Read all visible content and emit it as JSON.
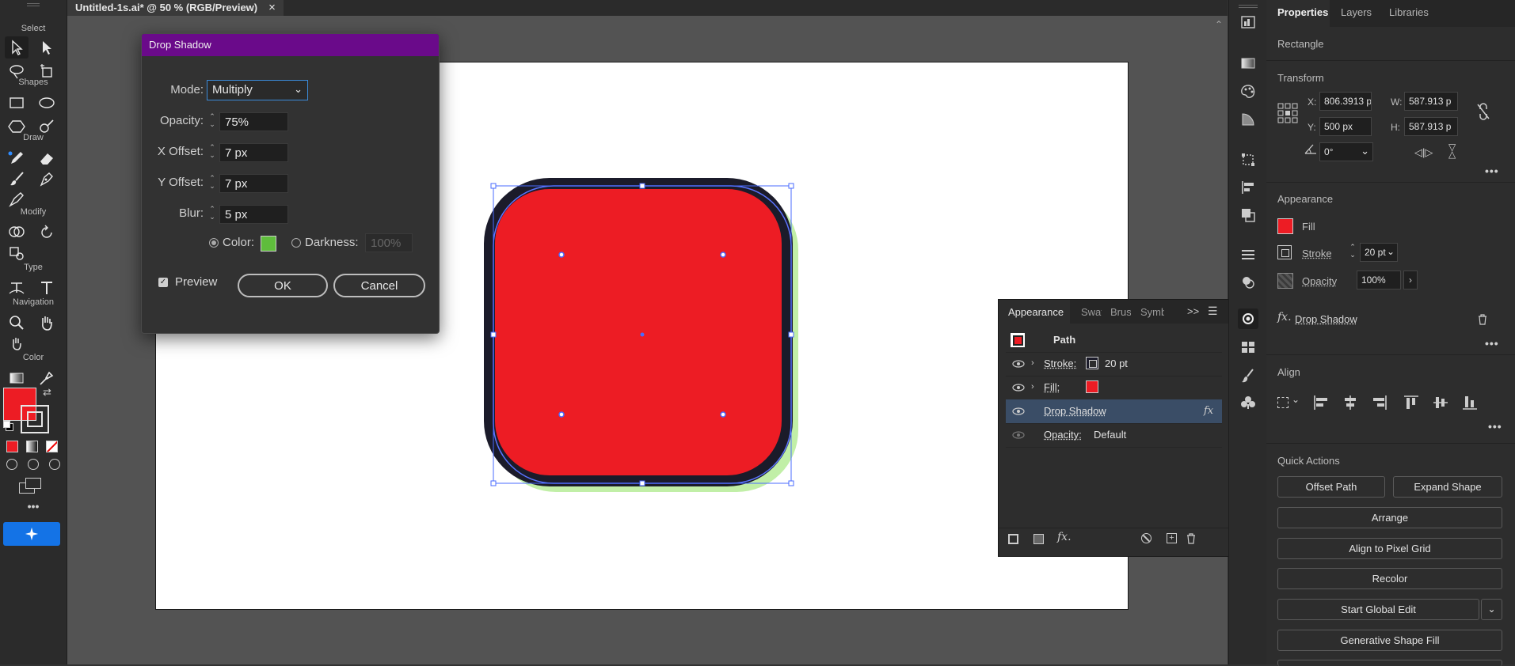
{
  "document_tab": {
    "title": "Untitled-1s.ai* @ 50 % (RGB/Preview)",
    "close": "×"
  },
  "toolbar": {
    "sections": [
      "Select",
      "Shapes",
      "Draw",
      "Modify",
      "Type",
      "Navigation",
      "Color"
    ],
    "more": "•••",
    "fill_color": "#ed1c24"
  },
  "dialog": {
    "title": "Drop Shadow",
    "mode_label": "Mode:",
    "mode_value": "Multiply",
    "opacity_label": "Opacity:",
    "opacity_value": "75%",
    "xoffset_label": "X Offset:",
    "xoffset_value": "7 px",
    "yoffset_label": "Y Offset:",
    "yoffset_value": "7 px",
    "blur_label": "Blur:",
    "blur_value": "5 px",
    "color_label": "Color:",
    "color_swatch": "#5fbd3c",
    "darkness_label": "Darkness:",
    "darkness_value": "100%",
    "preview_label": "Preview",
    "ok_label": "OK",
    "cancel_label": "Cancel"
  },
  "artwork": {
    "fill": "#ed1c24",
    "stroke": "#1b1b2a",
    "shadow": "#9ee07a",
    "selection": "#4a6bff"
  },
  "appearance_panel": {
    "tabs": [
      "Appearance",
      "Swat",
      "Brus",
      "Symb"
    ],
    "more": ">>",
    "title": "Path",
    "rows": [
      {
        "label": "Stroke:",
        "value": "20 pt"
      },
      {
        "label": "Fill:",
        "value": ""
      },
      {
        "label": "Drop Shadow",
        "value": ""
      },
      {
        "label": "Opacity:",
        "value": "Default"
      }
    ],
    "fx": "fx"
  },
  "properties": {
    "tabs": [
      "Properties",
      "Layers",
      "Libraries"
    ],
    "object_type": "Rectangle",
    "transform": {
      "heading": "Transform",
      "x_label": "X:",
      "x": "806.3913 p",
      "y_label": "Y:",
      "y": "500 px",
      "w_label": "W:",
      "w": "587.913 p",
      "h_label": "H:",
      "h": "587.913 p",
      "angle": "0°"
    },
    "appearance": {
      "heading": "Appearance",
      "fill_label": "Fill",
      "stroke_label": "Stroke",
      "stroke_value": "20 pt",
      "opacity_label": "Opacity",
      "opacity_value": "100%",
      "effect": "Drop Shadow"
    },
    "align_heading": "Align",
    "quick_actions": {
      "heading": "Quick Actions",
      "offset_path": "Offset Path",
      "expand_shape": "Expand Shape",
      "arrange": "Arrange",
      "align_pixel": "Align to Pixel Grid",
      "recolor": "Recolor",
      "global_edit": "Start Global Edit",
      "generative_fill": "Generative Shape Fill"
    },
    "more": "•••"
  }
}
